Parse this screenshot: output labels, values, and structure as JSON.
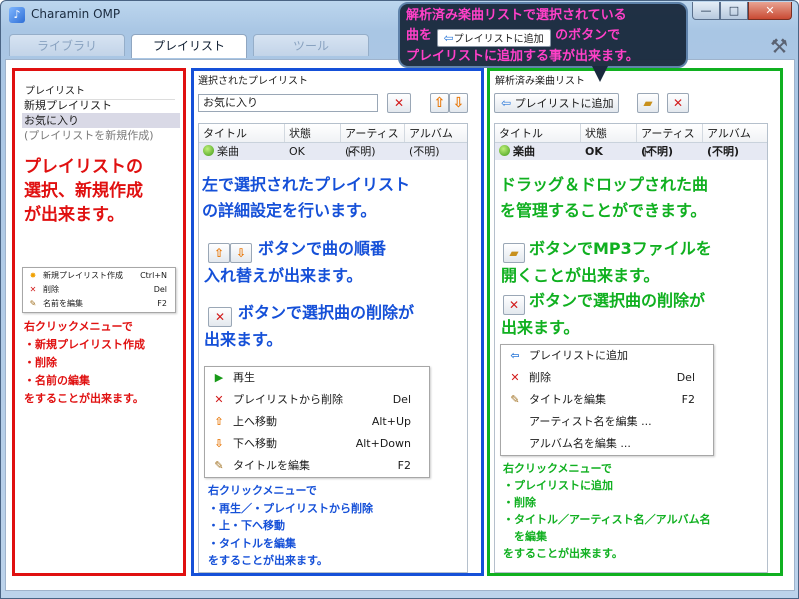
{
  "window": {
    "title": "Charamin OMP",
    "minimize": "—",
    "maximize": "□",
    "close": "✕"
  },
  "tabs": [
    {
      "label": "ライブラリ"
    },
    {
      "label": "プレイリスト"
    },
    {
      "label": "ツール"
    }
  ],
  "callout": {
    "line1": "解析済み楽曲リストで選択されている",
    "line2_pre": "曲を",
    "button_label": "プレイリストに追加",
    "line2_post": "のボタンで",
    "line3": "プレイリストに追加する事が出来ます。"
  },
  "left": {
    "header": "プレイリスト",
    "items": [
      "新規プレイリスト",
      "お気に入り"
    ],
    "hint": "(プレイリストを新規作成)",
    "annotation": [
      "プレイリストの",
      "選択、新規作成",
      "が出来ます。"
    ],
    "menu": [
      {
        "icon": "star",
        "label": "新規プレイリスト作成",
        "shortcut": "Ctrl+N"
      },
      {
        "icon": "x",
        "label": "削除",
        "shortcut": "Del"
      },
      {
        "icon": "pencil",
        "label": "名前を編集",
        "shortcut": "F2"
      }
    ],
    "menu_note": [
      "右クリックメニューで",
      "・新規プレイリスト作成",
      "・削除",
      "・名前の編集",
      "をすることが出来ます。"
    ]
  },
  "middle": {
    "header": "選択されたプレイリスト",
    "name_value": "お気に入り",
    "columns": [
      "タイトル",
      "状態",
      "アーティスト",
      "アルバム"
    ],
    "row": {
      "title": "楽曲",
      "status": "OK",
      "artist": "(不明)",
      "album": "(不明)"
    },
    "annotation1": [
      "左で選択されたプレイリスト",
      "の詳細設定を行います。"
    ],
    "annotation2_a": "ボタンで曲の順番",
    "annotation2_b": "入れ替えが出来ます。",
    "annotation3_a": "ボタンで選択曲の削除が",
    "annotation3_b": "出来ます。",
    "menu": [
      {
        "icon": "play",
        "label": "再生",
        "shortcut": ""
      },
      {
        "icon": "x",
        "label": "プレイリストから削除",
        "shortcut": "Del"
      },
      {
        "icon": "up",
        "label": "上へ移動",
        "shortcut": "Alt+Up"
      },
      {
        "icon": "down",
        "label": "下へ移動",
        "shortcut": "Alt+Down"
      },
      {
        "icon": "pencil",
        "label": "タイトルを編集",
        "shortcut": "F2"
      }
    ],
    "menu_note": [
      "右クリックメニューで",
      "・再生／・プレイリストから削除",
      "・上・下へ移動",
      "・タイトルを編集",
      "をすることが出来ます。"
    ]
  },
  "right": {
    "header": "解析済み楽曲リスト",
    "add_button": "プレイリストに追加",
    "columns": [
      "タイトル",
      "状態",
      "アーティスト",
      "アルバム"
    ],
    "row": {
      "title": "楽曲",
      "status": "OK",
      "artist": "(不明)",
      "album": "(不明)"
    },
    "annotation1": [
      "ドラッグ＆ドロップされた曲",
      "を管理することができます。"
    ],
    "annotation2_a": "ボタンでMP3ファイルを",
    "annotation2_b": "開くことが出来ます。",
    "annotation3_a": "ボタンで選択曲の削除が",
    "annotation3_b": "出来ます。",
    "menu": [
      {
        "icon": "arrow",
        "label": "プレイリストに追加",
        "shortcut": ""
      },
      {
        "icon": "x",
        "label": "削除",
        "shortcut": "Del"
      },
      {
        "icon": "pencil",
        "label": "タイトルを編集",
        "shortcut": "F2"
      },
      {
        "icon": "",
        "label": "アーティスト名を編集 ...",
        "shortcut": ""
      },
      {
        "icon": "",
        "label": "アルバム名を編集 ...",
        "shortcut": ""
      }
    ],
    "menu_note": [
      "右クリックメニューで",
      "・プレイリストに追加",
      "・削除",
      "・タイトル／アーティスト名／アルバム名",
      "　を編集",
      "をすることが出来ます。"
    ]
  },
  "colors": {
    "red": "#e01010",
    "blue": "#1550d8",
    "green": "#10b020",
    "callout_text": "#ff40c8"
  }
}
